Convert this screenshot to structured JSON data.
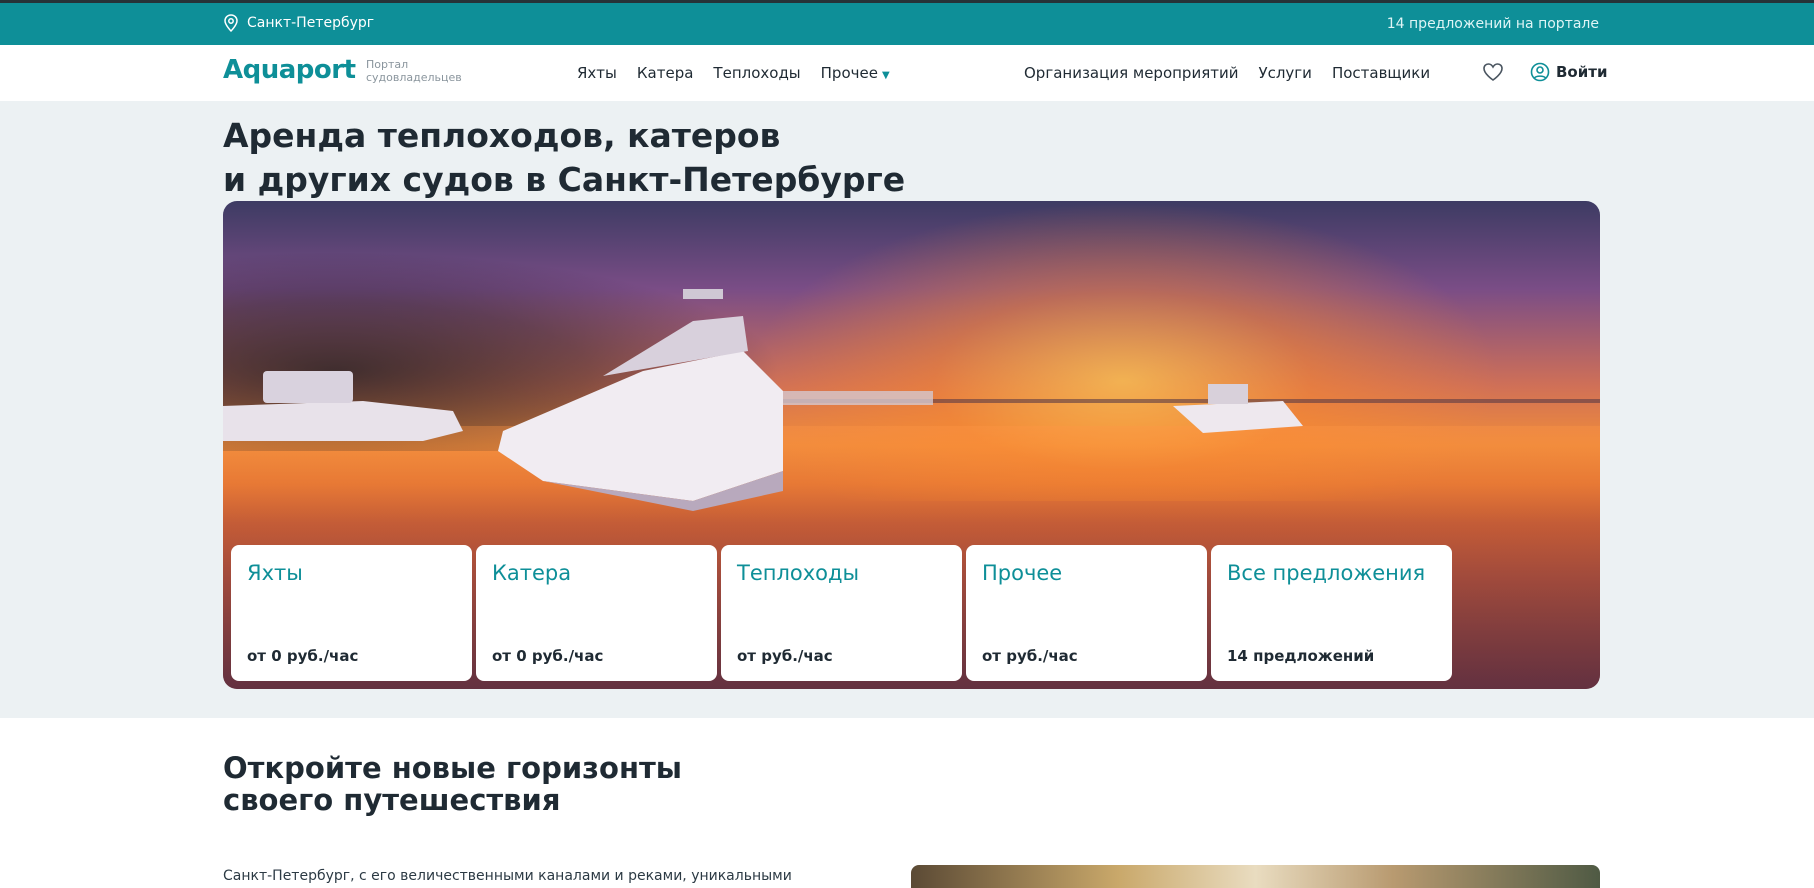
{
  "topbar": {
    "city": "Санкт-Петербург",
    "offers": "14 предложений на портале",
    "city_icon": "map-pin-icon"
  },
  "header": {
    "logo": "Aquaport",
    "tagline": "Портал судовладельцев",
    "nav_left": [
      "Яхты",
      "Катера",
      "Теплоходы",
      "Прочее"
    ],
    "nav_right": [
      "Организация мероприятий",
      "Услуги",
      "Поставщики"
    ],
    "favorites_icon": "heart-icon",
    "login_label": "Войти",
    "login_icon": "user-circle-icon"
  },
  "hero": {
    "title_line1": "Аренда теплоходов, катеров",
    "title_line2": "и других судов в Санкт-Петербурге",
    "cards": [
      {
        "title": "Яхты",
        "price": "от 0 руб./час"
      },
      {
        "title": "Катера",
        "price": "от 0 руб./час"
      },
      {
        "title": "Теплоходы",
        "price": "от руб./час"
      },
      {
        "title": "Прочее",
        "price": "от руб./час"
      },
      {
        "title": "Все предложения",
        "price": "14 предложений"
      }
    ]
  },
  "section2": {
    "title_line1": "Откройте новые горизонты",
    "title_line2": "своего путешествия",
    "paragraph": "Санкт-Петербург, с его величественными каналами и реками, уникальными"
  },
  "colors": {
    "accent": "#0e8f98",
    "text": "#1f2a33",
    "hero_bg": "#ecf1f3"
  }
}
